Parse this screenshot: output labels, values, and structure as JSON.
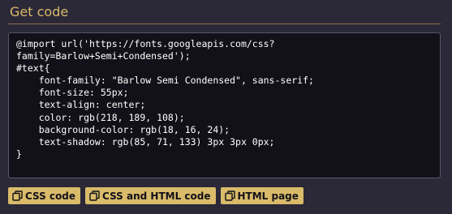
{
  "panel": {
    "title": "Get code"
  },
  "code": {
    "text": "@import url('https://fonts.googleapis.com/css?\nfamily=Barlow+Semi+Condensed');\n#text{\n    font-family: \"Barlow Semi Condensed\", sans-serif;\n    font-size: 55px;\n    text-align: center;\n    color: rgb(218, 189, 108);\n    background-color: rgb(18, 16, 24);\n    text-shadow: rgb(85, 71, 133) 3px 3px 0px;\n}"
  },
  "buttons": [
    {
      "label": "CSS code",
      "icon": "copy-icon"
    },
    {
      "label": "CSS and HTML code",
      "icon": "copy-icon"
    },
    {
      "label": "HTML page",
      "icon": "copy-icon"
    }
  ],
  "colors": {
    "background": "#2b2838",
    "accent": "#d9bb6a",
    "code_background": "#121018",
    "code_text": "#ffffff"
  }
}
